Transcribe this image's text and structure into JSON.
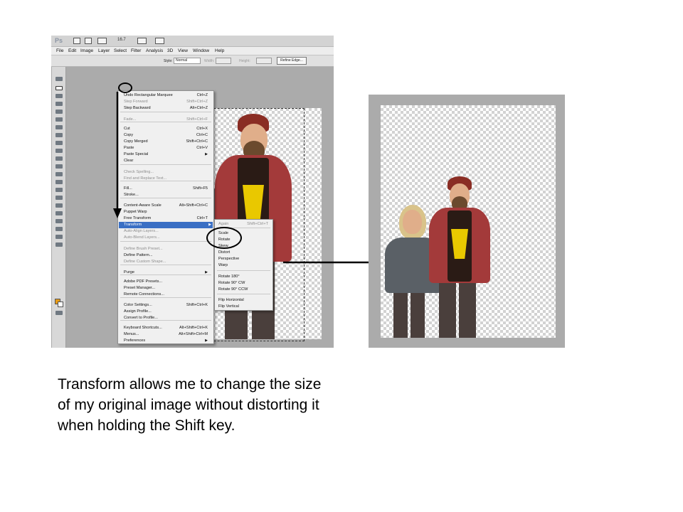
{
  "photoshop": {
    "app_logo": "Ps",
    "zoom_level": "16.7",
    "menubar": [
      "File",
      "Edit",
      "Image",
      "Layer",
      "Select",
      "Filter",
      "Analysis",
      "3D",
      "View",
      "Window",
      "Help"
    ],
    "options_bar": {
      "style_label": "Style:",
      "style_value": "Normal",
      "width_label": "Width:",
      "height_label": "Height:",
      "refine_edge_label": "Refine Edge..."
    },
    "edit_menu": [
      {
        "label": "Undo Rectangular Marquee",
        "shortcut": "Ctrl+Z",
        "disabled": false
      },
      {
        "label": "Step Forward",
        "shortcut": "Shift+Ctrl+Z",
        "disabled": true
      },
      {
        "label": "Step Backward",
        "shortcut": "Alt+Ctrl+Z",
        "disabled": false
      },
      {
        "label": "Fade...",
        "shortcut": "Shift+Ctrl+F",
        "disabled": true
      },
      {
        "label": "Cut",
        "shortcut": "Ctrl+X",
        "disabled": false
      },
      {
        "label": "Copy",
        "shortcut": "Ctrl+C",
        "disabled": false
      },
      {
        "label": "Copy Merged",
        "shortcut": "Shift+Ctrl+C",
        "disabled": false
      },
      {
        "label": "Paste",
        "shortcut": "Ctrl+V",
        "disabled": false
      },
      {
        "label": "Paste Special",
        "shortcut": "",
        "disabled": false,
        "submenu": true
      },
      {
        "label": "Clear",
        "shortcut": "",
        "disabled": false
      },
      {
        "label": "Check Spelling...",
        "shortcut": "",
        "disabled": true
      },
      {
        "label": "Find and Replace Text...",
        "shortcut": "",
        "disabled": true
      },
      {
        "label": "Fill...",
        "shortcut": "Shift+F5",
        "disabled": false
      },
      {
        "label": "Stroke...",
        "shortcut": "",
        "disabled": false
      },
      {
        "label": "Content-Aware Scale",
        "shortcut": "Alt+Shift+Ctrl+C",
        "disabled": false
      },
      {
        "label": "Puppet Warp",
        "shortcut": "",
        "disabled": false
      },
      {
        "label": "Free Transform",
        "shortcut": "Ctrl+T",
        "disabled": false
      },
      {
        "label": "Transform",
        "shortcut": "",
        "disabled": false,
        "submenu": true,
        "highlighted": true
      },
      {
        "label": "Auto-Align Layers...",
        "shortcut": "",
        "disabled": true
      },
      {
        "label": "Auto-Blend Layers...",
        "shortcut": "",
        "disabled": true
      },
      {
        "label": "Define Brush Preset...",
        "shortcut": "",
        "disabled": true
      },
      {
        "label": "Define Pattern...",
        "shortcut": "",
        "disabled": false
      },
      {
        "label": "Define Custom Shape...",
        "shortcut": "",
        "disabled": true
      },
      {
        "label": "Purge",
        "shortcut": "",
        "disabled": false,
        "submenu": true
      },
      {
        "label": "Adobe PDF Presets...",
        "shortcut": "",
        "disabled": false
      },
      {
        "label": "Preset Manager...",
        "shortcut": "",
        "disabled": false
      },
      {
        "label": "Remote Connections...",
        "shortcut": "",
        "disabled": false
      },
      {
        "label": "Color Settings...",
        "shortcut": "Shift+Ctrl+K",
        "disabled": false
      },
      {
        "label": "Assign Profile...",
        "shortcut": "",
        "disabled": false
      },
      {
        "label": "Convert to Profile...",
        "shortcut": "",
        "disabled": false
      },
      {
        "label": "Keyboard Shortcuts...",
        "shortcut": "Alt+Shift+Ctrl+K",
        "disabled": false
      },
      {
        "label": "Menus...",
        "shortcut": "Alt+Shift+Ctrl+M",
        "disabled": false
      },
      {
        "label": "Preferences",
        "shortcut": "",
        "disabled": false,
        "submenu": true
      }
    ],
    "transform_submenu": [
      {
        "label": "Again",
        "shortcut": "Shift+Ctrl+T",
        "disabled": true
      },
      {
        "label": "Scale",
        "shortcut": "",
        "disabled": false
      },
      {
        "label": "Rotate",
        "shortcut": "",
        "disabled": false
      },
      {
        "label": "Skew",
        "shortcut": "",
        "disabled": false
      },
      {
        "label": "Distort",
        "shortcut": "",
        "disabled": false
      },
      {
        "label": "Perspective",
        "shortcut": "",
        "disabled": false
      },
      {
        "label": "Warp",
        "shortcut": "",
        "disabled": false
      },
      {
        "label": "Rotate 180°",
        "shortcut": "",
        "disabled": false
      },
      {
        "label": "Rotate 90° CW",
        "shortcut": "",
        "disabled": false
      },
      {
        "label": "Rotate 90° CCW",
        "shortcut": "",
        "disabled": false
      },
      {
        "label": "Flip Horizontal",
        "shortcut": "",
        "disabled": false
      },
      {
        "label": "Flip Vertical",
        "shortcut": "",
        "disabled": false
      }
    ],
    "foreground_color": "#e89b15",
    "background_color": "#ffffff",
    "highlight_color": "#3a6fc4"
  },
  "caption": "Transform allows me to change the size of my original image without distorting it when holding the Shift key."
}
